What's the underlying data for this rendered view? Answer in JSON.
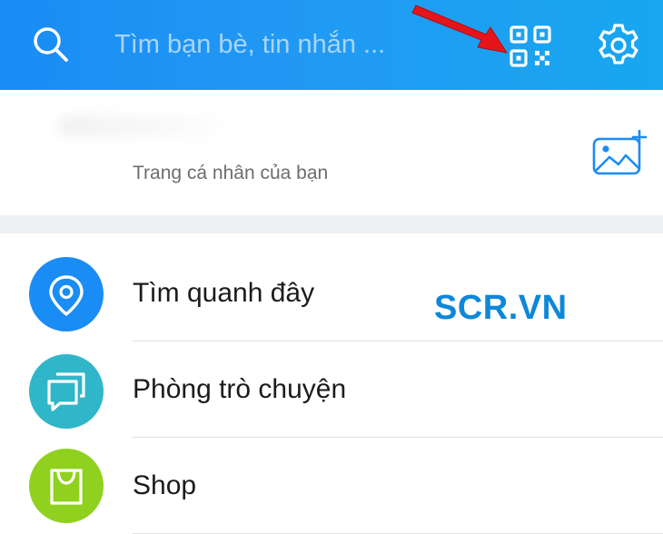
{
  "header": {
    "search_placeholder": "Tìm bạn bè, tin nhắn ...",
    "colors": {
      "gradient_start": "#1a8cf5",
      "gradient_end": "#18a7f0"
    }
  },
  "profile": {
    "subtitle": "Trang cá nhân của bạn"
  },
  "menu": {
    "items": [
      {
        "label": "Tìm quanh đây",
        "icon": "location-pin-icon",
        "color": "#1a8cf5"
      },
      {
        "label": "Phòng trò chuyện",
        "icon": "chat-bubbles-icon",
        "color": "#2fb6c8"
      },
      {
        "label": "Shop",
        "icon": "shopping-bag-icon",
        "color": "#8fd11e"
      }
    ]
  },
  "watermark": "SCR.VN"
}
